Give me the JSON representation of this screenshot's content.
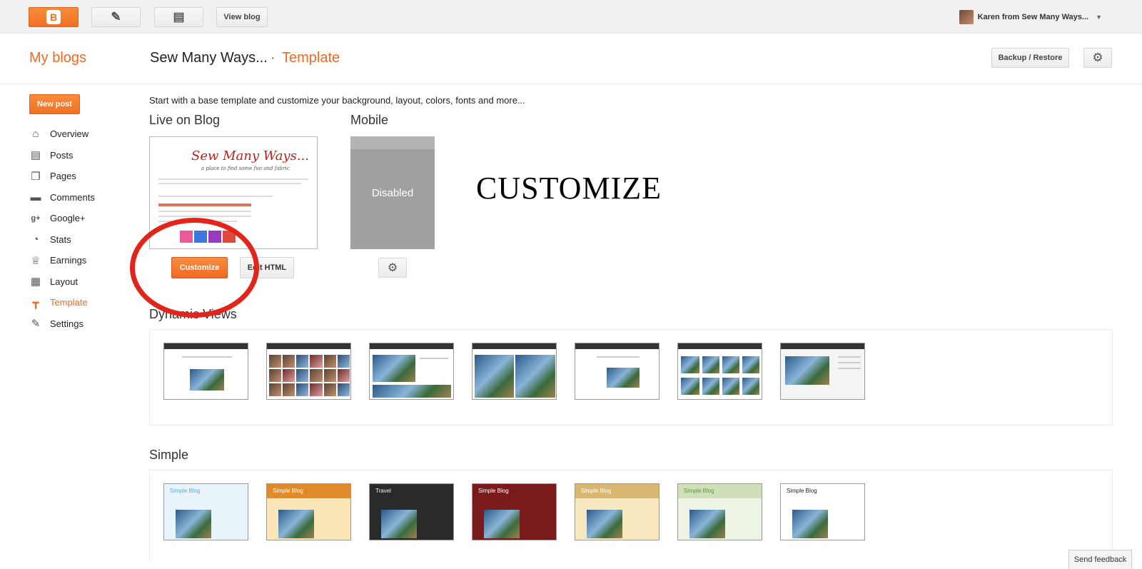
{
  "topbar": {
    "blogger_logo": "B",
    "pencil_icon": "✎",
    "pages_icon": "▤",
    "view_blog_label": "View blog",
    "user_name": "Karen from Sew Many Ways...",
    "caret": "▼"
  },
  "header": {
    "my_blogs": "My blogs",
    "blog_name": "Sew Many Ways...",
    "separator": "·",
    "section": "Template",
    "backup_label": "Backup / Restore",
    "gear_icon": "⚙"
  },
  "sidebar": {
    "new_post_label": "New post",
    "items": [
      {
        "label": "Overview",
        "icon": "⌂"
      },
      {
        "label": "Posts",
        "icon": "▤"
      },
      {
        "label": "Pages",
        "icon": "❐"
      },
      {
        "label": "Comments",
        "icon": "▬"
      },
      {
        "label": "Google+",
        "icon": "g+"
      },
      {
        "label": "Stats",
        "icon": "◔"
      },
      {
        "label": "Earnings",
        "icon": "♕"
      },
      {
        "label": "Layout",
        "icon": "▦"
      },
      {
        "label": "Template",
        "icon": "┳"
      },
      {
        "label": "Settings",
        "icon": "✎"
      }
    ],
    "active": "Template"
  },
  "main": {
    "intro": "Start with a base template and customize your background, layout, colors, fonts and more...",
    "live_title": "Live on Blog",
    "mobile_title": "Mobile",
    "live_thumb_title": "Sew Many Ways...",
    "live_thumb_subtitle": "a place to find some fun and fabric",
    "mobile_status": "Disabled",
    "customize_label": "Customize",
    "edit_html_label": "Edit HTML",
    "mobile_gear_icon": "⚙",
    "annotation": "CUSTOMIZE",
    "dynamic_views_title": "Dynamic Views",
    "simple_title": "Simple",
    "simple_templates": [
      "Simple Blog",
      "Simple Blog",
      "Travel",
      "Simple Blog",
      "Simple Blog",
      "Simple Blog",
      "Simple Blog"
    ]
  },
  "feedback_label": "Send feedback",
  "colors": {
    "accent": "#f06a22",
    "annotation_circle": "#e2241a"
  }
}
